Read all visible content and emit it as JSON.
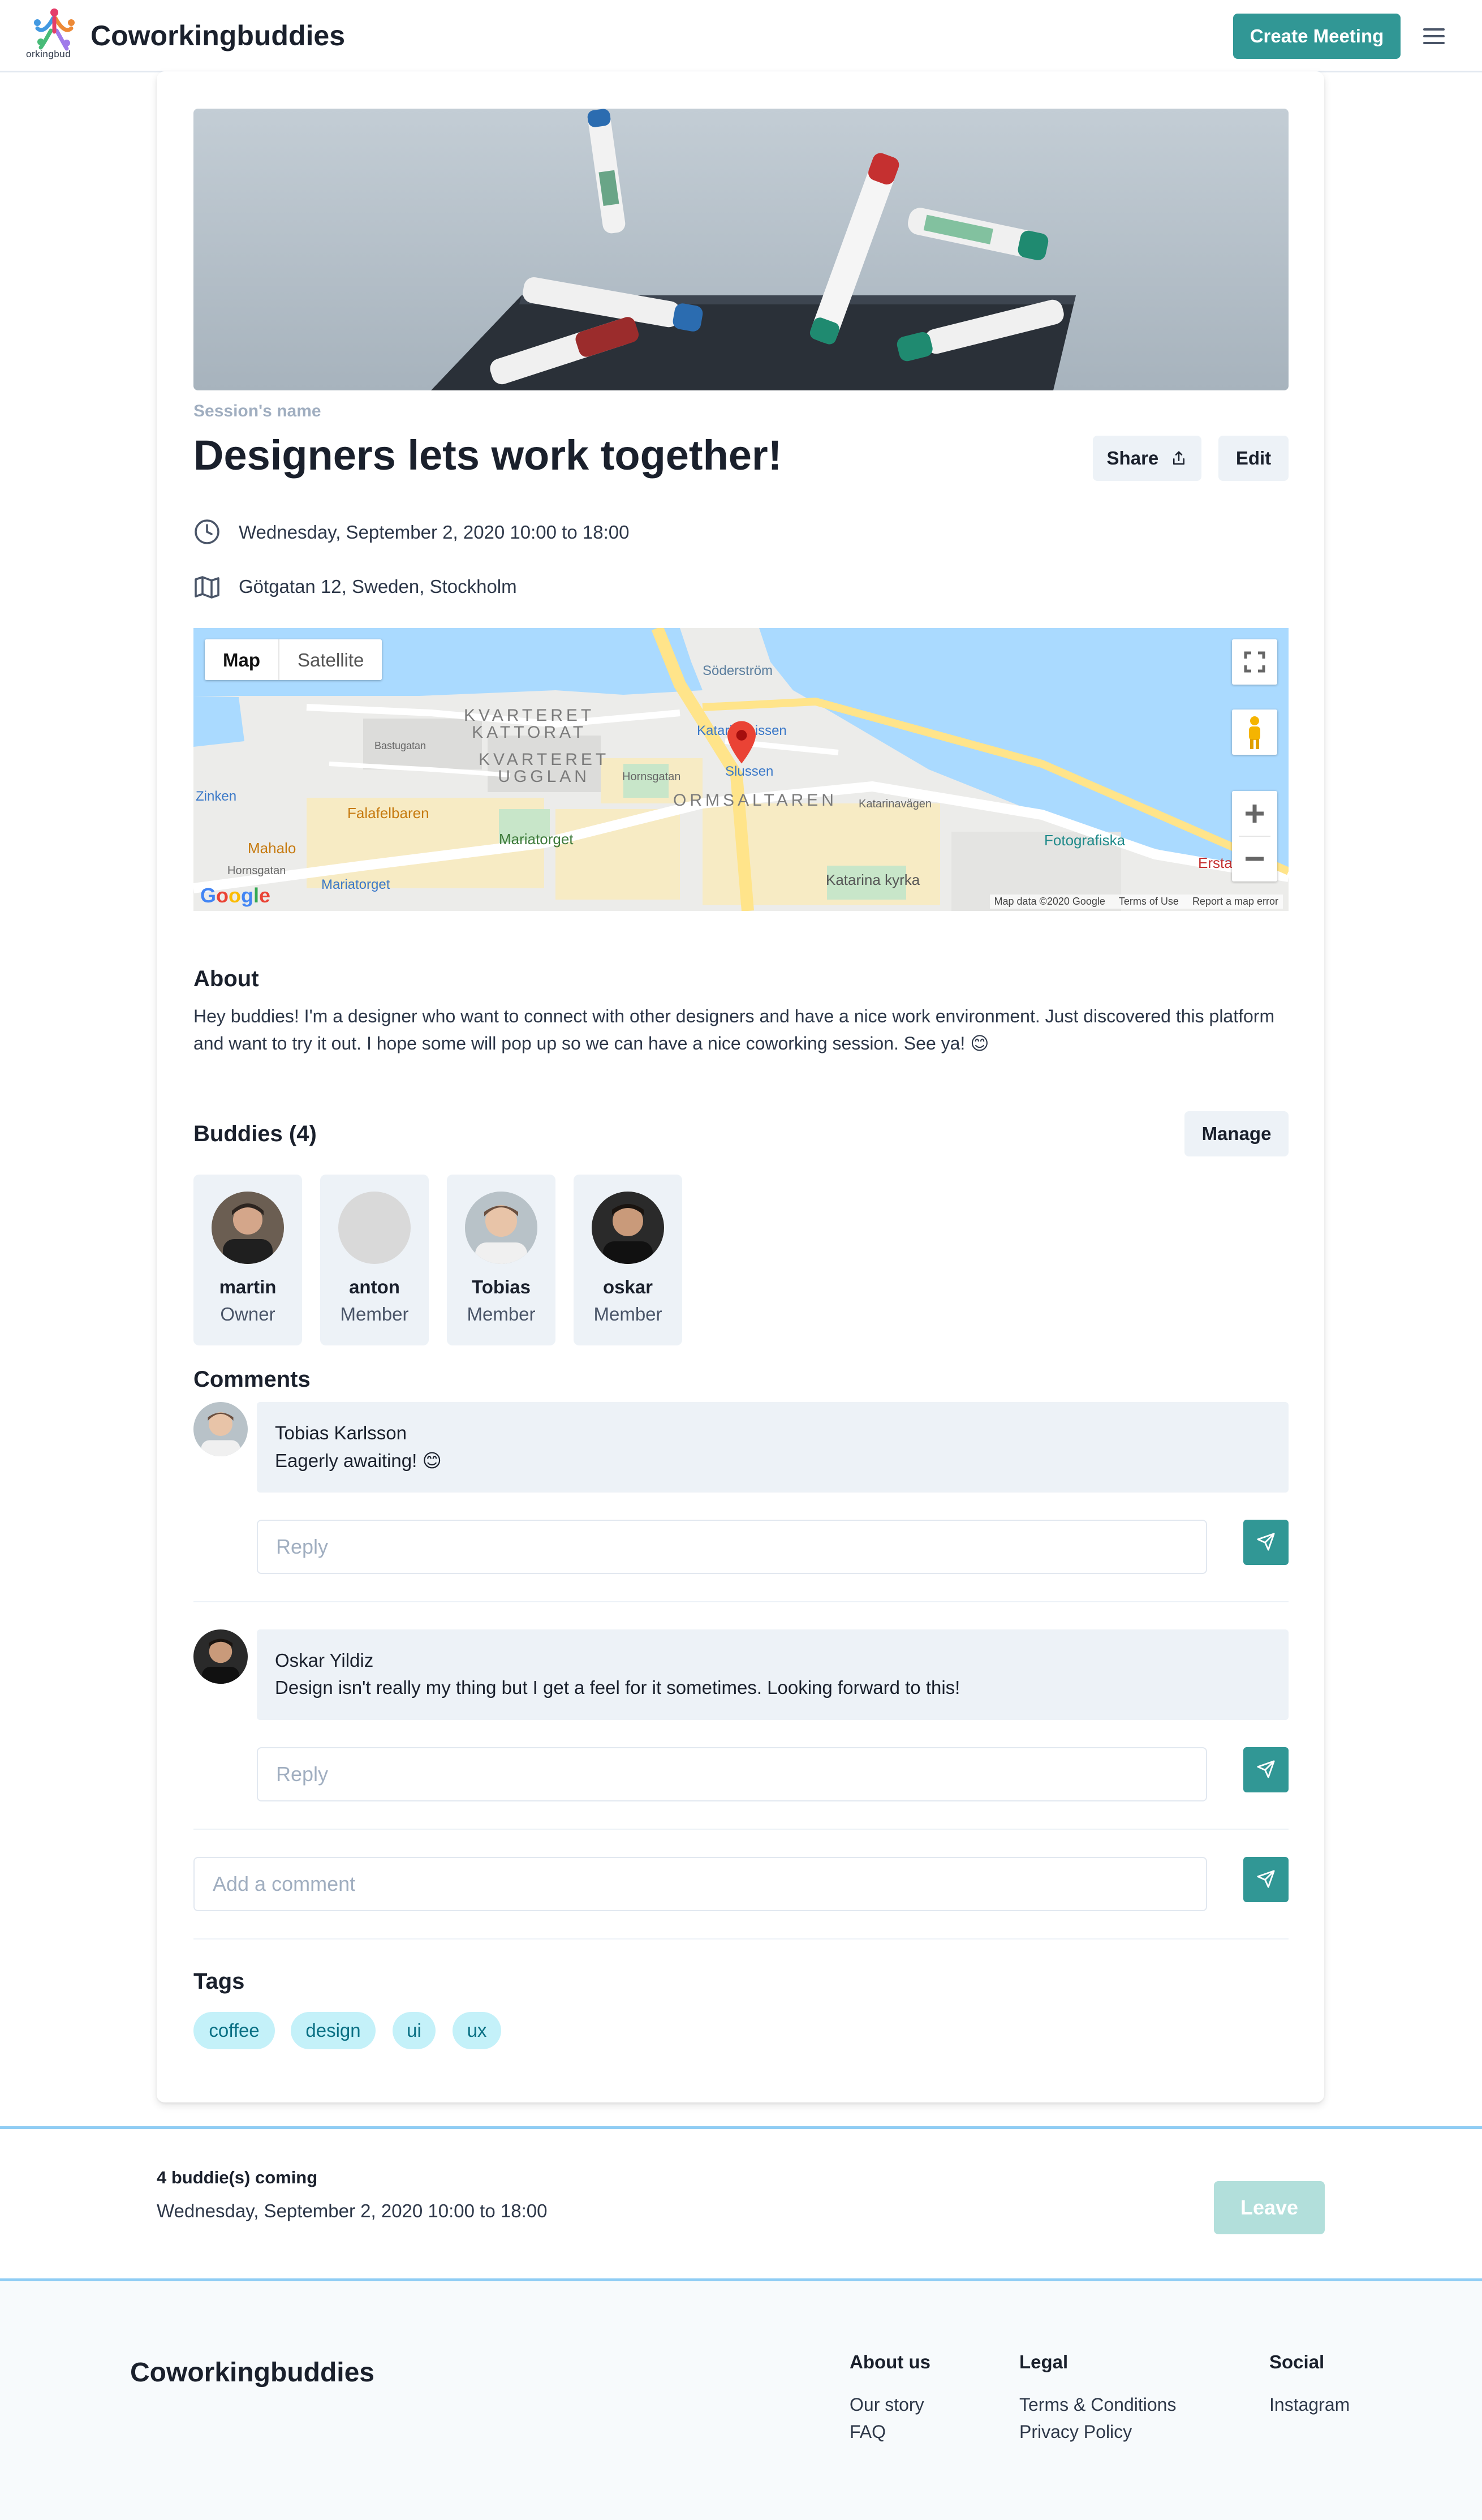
{
  "header": {
    "logo_text": "orkingbud",
    "brand": "Coworkingbuddies",
    "create_button": "Create Meeting"
  },
  "session": {
    "label": "Session's name",
    "title": "Designers lets work together!",
    "share_label": "Share",
    "edit_label": "Edit",
    "datetime": "Wednesday, September 2, 2020 10:00 to 18:00",
    "address": "Götgatan 12, Sweden, Stockholm"
  },
  "map": {
    "tab_map": "Map",
    "tab_satellite": "Satellite",
    "labels": {
      "kvarteret_kattorat": "KVARTERET\nKATTORAT",
      "kvarteret_ugglan": "KVARTERET\nUGGLAN",
      "sodermalm": "ORMSALTAREN",
      "slussen": "Slussen",
      "katarinahissen": "Katarinahissen",
      "soderstrom": "Söderström",
      "zinken": "Zinken",
      "mahalo": "Mahalo",
      "falafelbaren": "Falafelbaren",
      "mariatorget": "Mariatorget",
      "mariatorget_station": "Mariatorget",
      "katarina_kyrka": "Katarina kyrka",
      "fotografiska": "Fotografiska",
      "katarinavagen": "Katarinavägen",
      "hornsgatan": "Hornsgatan",
      "hornsgatan2": "Hornsgatan",
      "bastugatan": "Bastugatan",
      "ersta": "Ersta"
    },
    "google": "Google",
    "attrib_data": "Map data ©2020 Google",
    "attrib_terms": "Terms of Use",
    "attrib_report": "Report a map error"
  },
  "about": {
    "heading": "About",
    "text": "Hey buddies! I'm a designer who want to connect with other designers and have a nice work environment. Just discovered this platform and want to try it out. I hope some will pop up so we can have a nice coworking session. See ya! 😊"
  },
  "buddies": {
    "heading": "Buddies (4)",
    "manage_label": "Manage",
    "items": [
      {
        "name": "martin",
        "role": "Owner"
      },
      {
        "name": "anton",
        "role": "Member"
      },
      {
        "name": "Tobias",
        "role": "Member"
      },
      {
        "name": "oskar",
        "role": "Member"
      }
    ]
  },
  "comments": {
    "heading": "Comments",
    "items": [
      {
        "author": "Tobias Karlsson",
        "text": "Eagerly awaiting! 😊",
        "reply_placeholder": "Reply"
      },
      {
        "author": "Oskar Yildiz",
        "text": "Design isn't really my thing but I get a feel for it sometimes. Looking forward to this!",
        "reply_placeholder": "Reply"
      }
    ],
    "add_placeholder": "Add a comment"
  },
  "tags": {
    "heading": "Tags",
    "items": [
      "coffee",
      "design",
      "ui",
      "ux"
    ]
  },
  "bottom_bar": {
    "count": "4 buddie(s) coming",
    "datetime": "Wednesday, September 2, 2020 10:00 to 18:00",
    "leave_label": "Leave"
  },
  "footer": {
    "brand": "Coworkingbuddies",
    "about_heading": "About us",
    "about_links": [
      "Our story",
      "FAQ"
    ],
    "legal_heading": "Legal",
    "legal_links": [
      "Terms & Conditions",
      "Privacy Policy"
    ],
    "social_heading": "Social",
    "social_links": [
      "Instagram"
    ]
  },
  "colors": {
    "accent": "#319795",
    "tag_bg": "#c4f1f9",
    "tag_text": "#086f83",
    "bar_border": "#90cdf4"
  }
}
